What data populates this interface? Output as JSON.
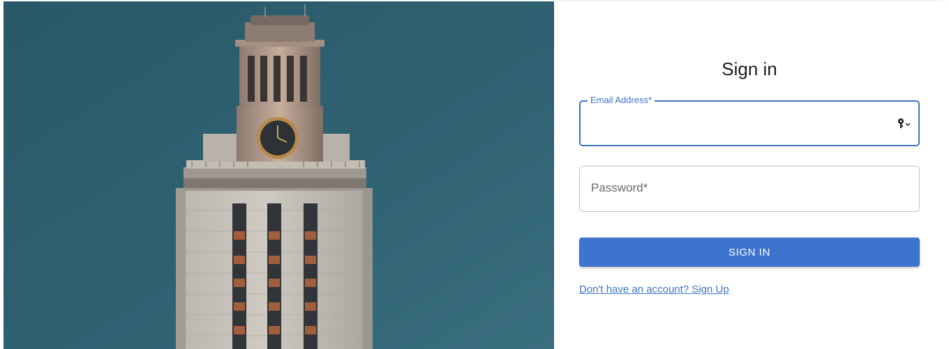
{
  "hero": {
    "image_icon": "clock-tower-illustration"
  },
  "form": {
    "title": "Sign in",
    "email": {
      "label": "Email Address",
      "required_mark": "*",
      "value": "",
      "icon": "key-icon"
    },
    "password": {
      "label": "Password",
      "required_mark": "*",
      "value": ""
    },
    "submit_label": "SIGN IN",
    "signup_link": "Don't have an account? Sign Up"
  },
  "colors": {
    "accent": "#3d74cf",
    "sky": "#2f5f6e",
    "border": "#c4c4c4"
  }
}
